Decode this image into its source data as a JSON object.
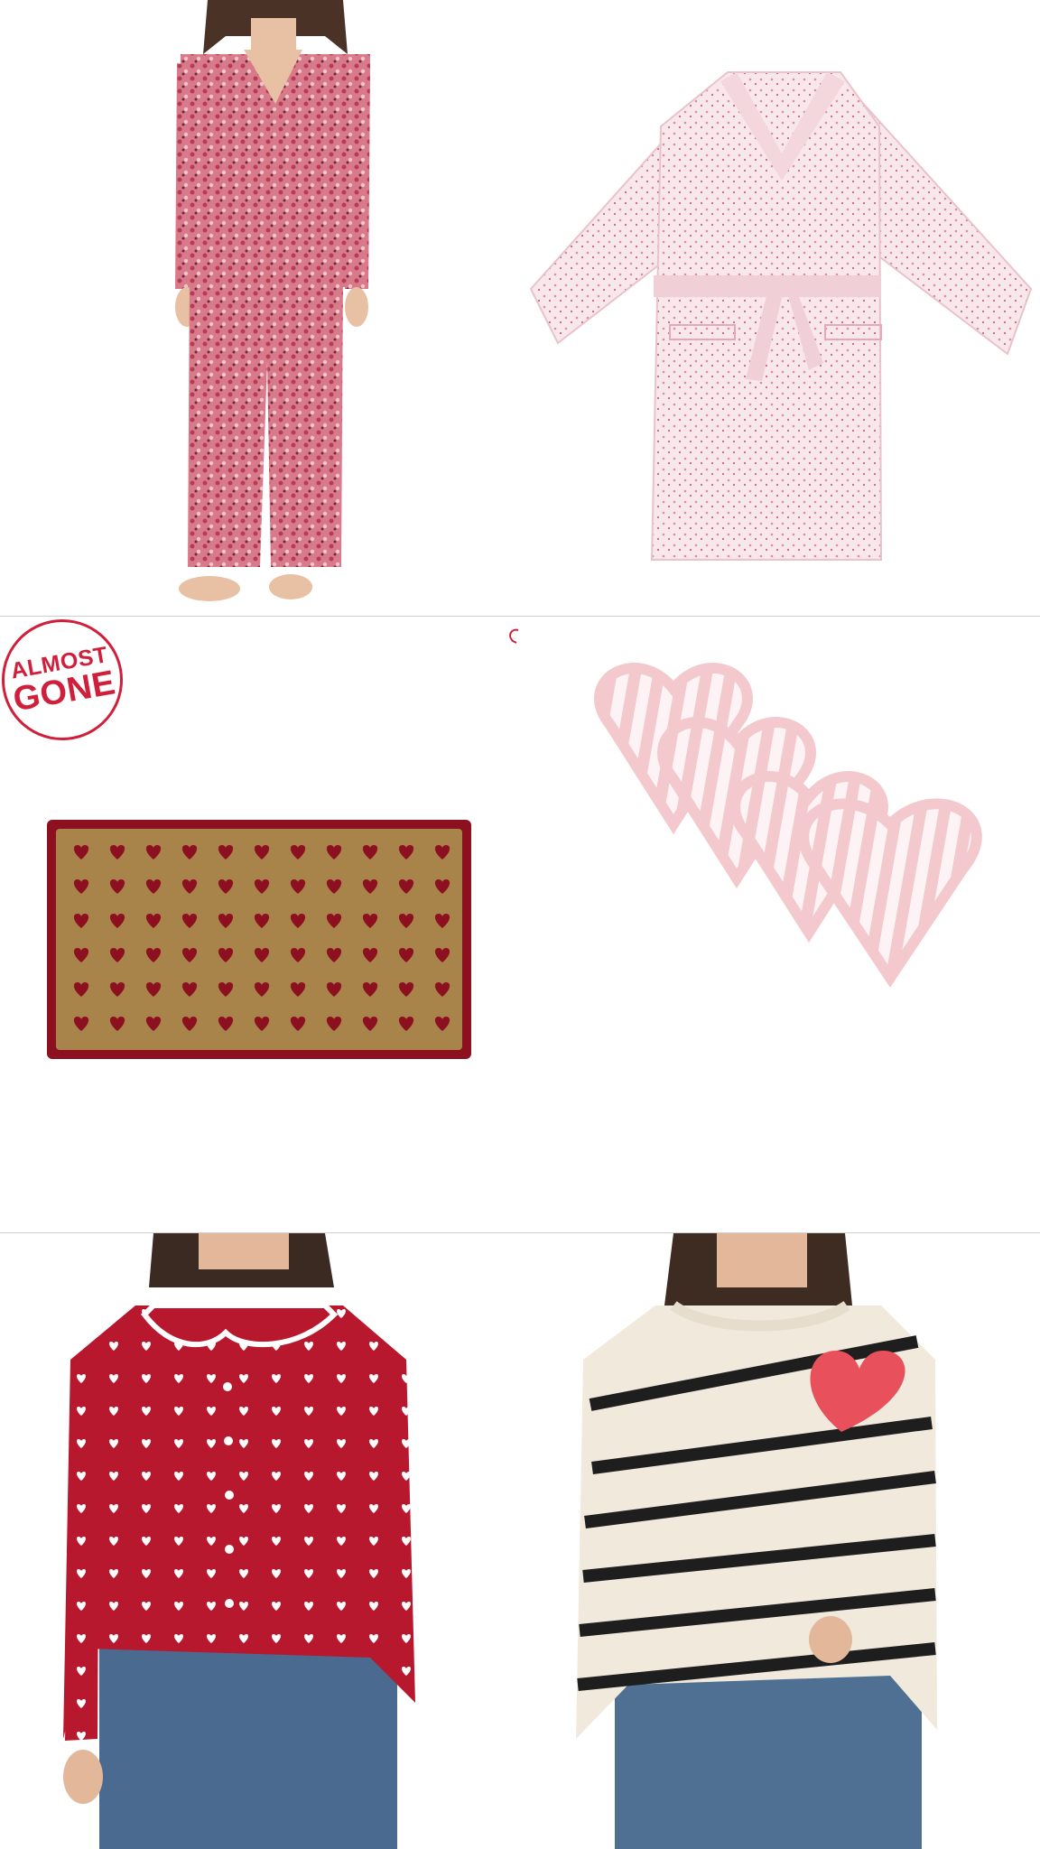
{
  "products": [
    {
      "name": "pajama-set",
      "icon": "floral-pajama-set-image"
    },
    {
      "name": "robe",
      "icon": "floral-robe-image"
    },
    {
      "name": "doormat",
      "icon": "heart-doormat-image"
    },
    {
      "name": "coasters",
      "icon": "heart-ruffle-coasters-image"
    },
    {
      "name": "cardigan",
      "icon": "red-heart-cardigan-image"
    },
    {
      "name": "sweater",
      "icon": "striped-heart-sweater-image"
    }
  ],
  "badge": {
    "line1": "ALMOST",
    "line2": "GONE"
  },
  "colors": {
    "badge_red": "#d01f3a",
    "divider": "#cfcfcf",
    "coir": "#a8834a",
    "mat_red": "#8c1020",
    "cardigan_red": "#b8182e",
    "coaster_pink": "#f3c9cd"
  }
}
